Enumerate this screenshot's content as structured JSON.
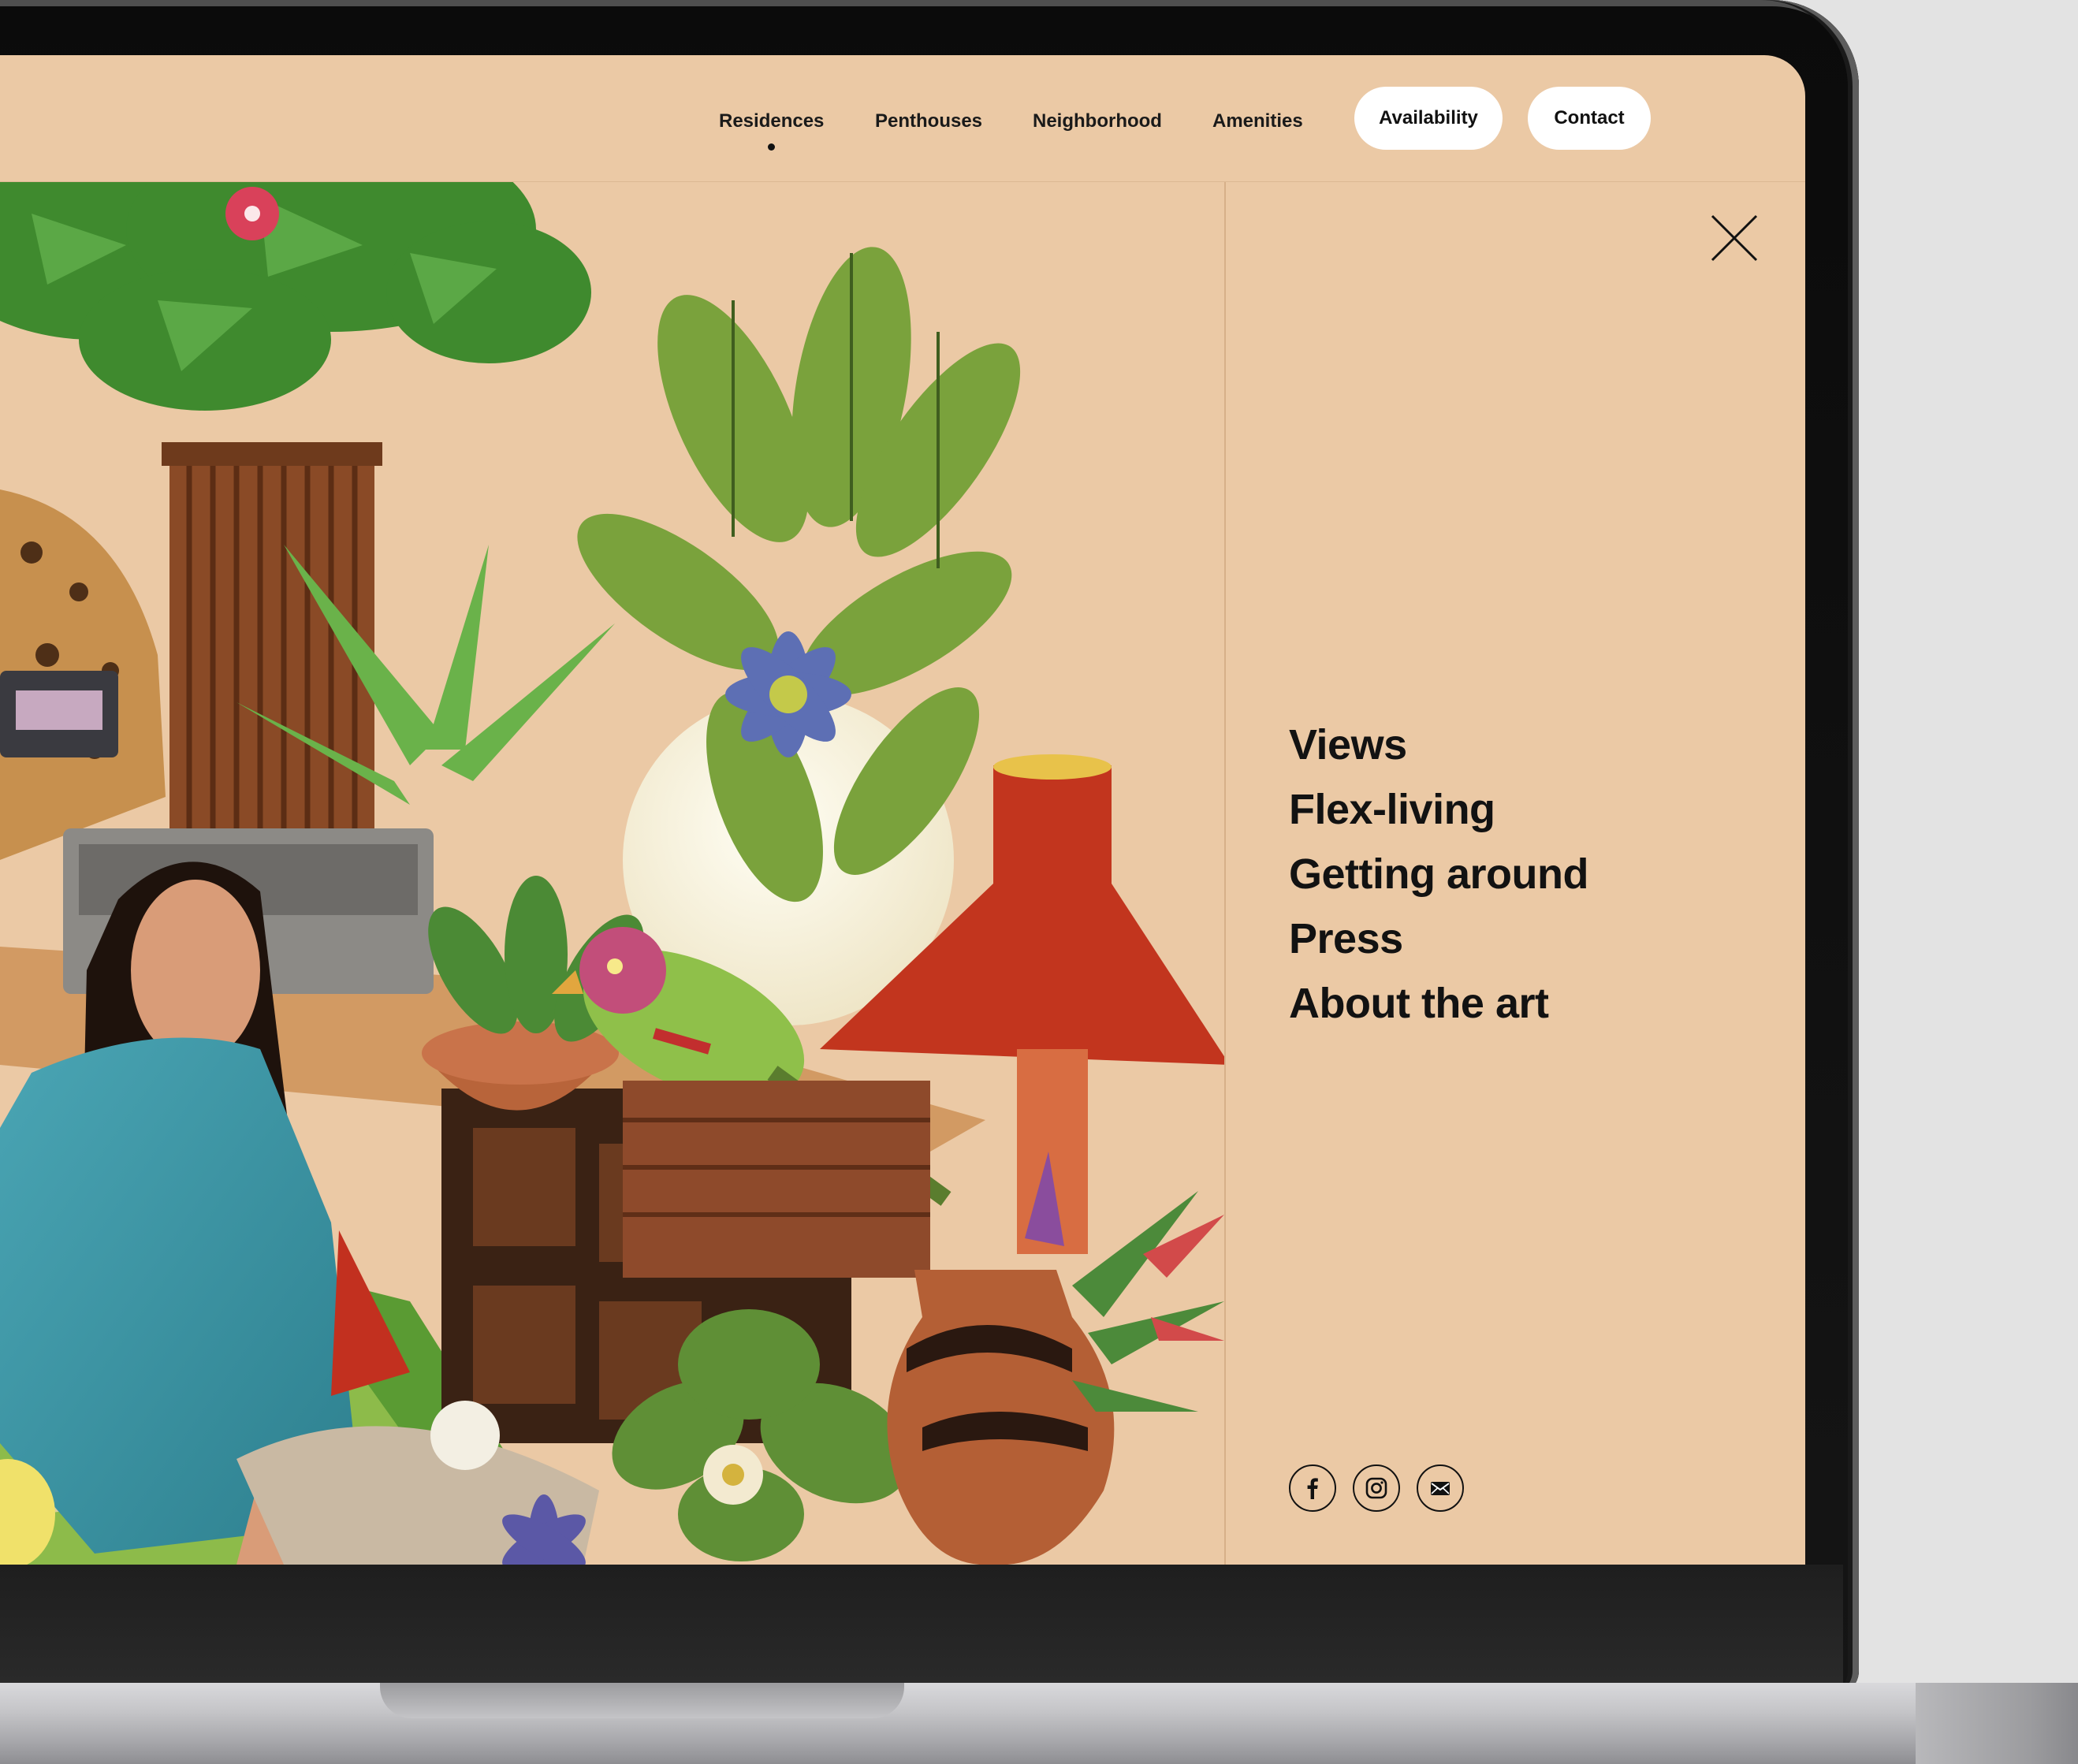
{
  "header": {
    "nav": [
      "Residences",
      "Penthouses",
      "Neighborhood",
      "Amenities"
    ],
    "active_index": 0,
    "buttons": {
      "availability": "Availability",
      "contact": "Contact"
    }
  },
  "menu": {
    "items": [
      "Views",
      "Flex-living",
      "Getting around",
      "Press",
      "About the art"
    ]
  },
  "social": [
    "facebook-icon",
    "instagram-icon",
    "email-icon"
  ],
  "colors": {
    "background": "#ebc9a5",
    "text": "#121212",
    "pill": "#ffffff",
    "bezel": "#0b0b0b"
  }
}
